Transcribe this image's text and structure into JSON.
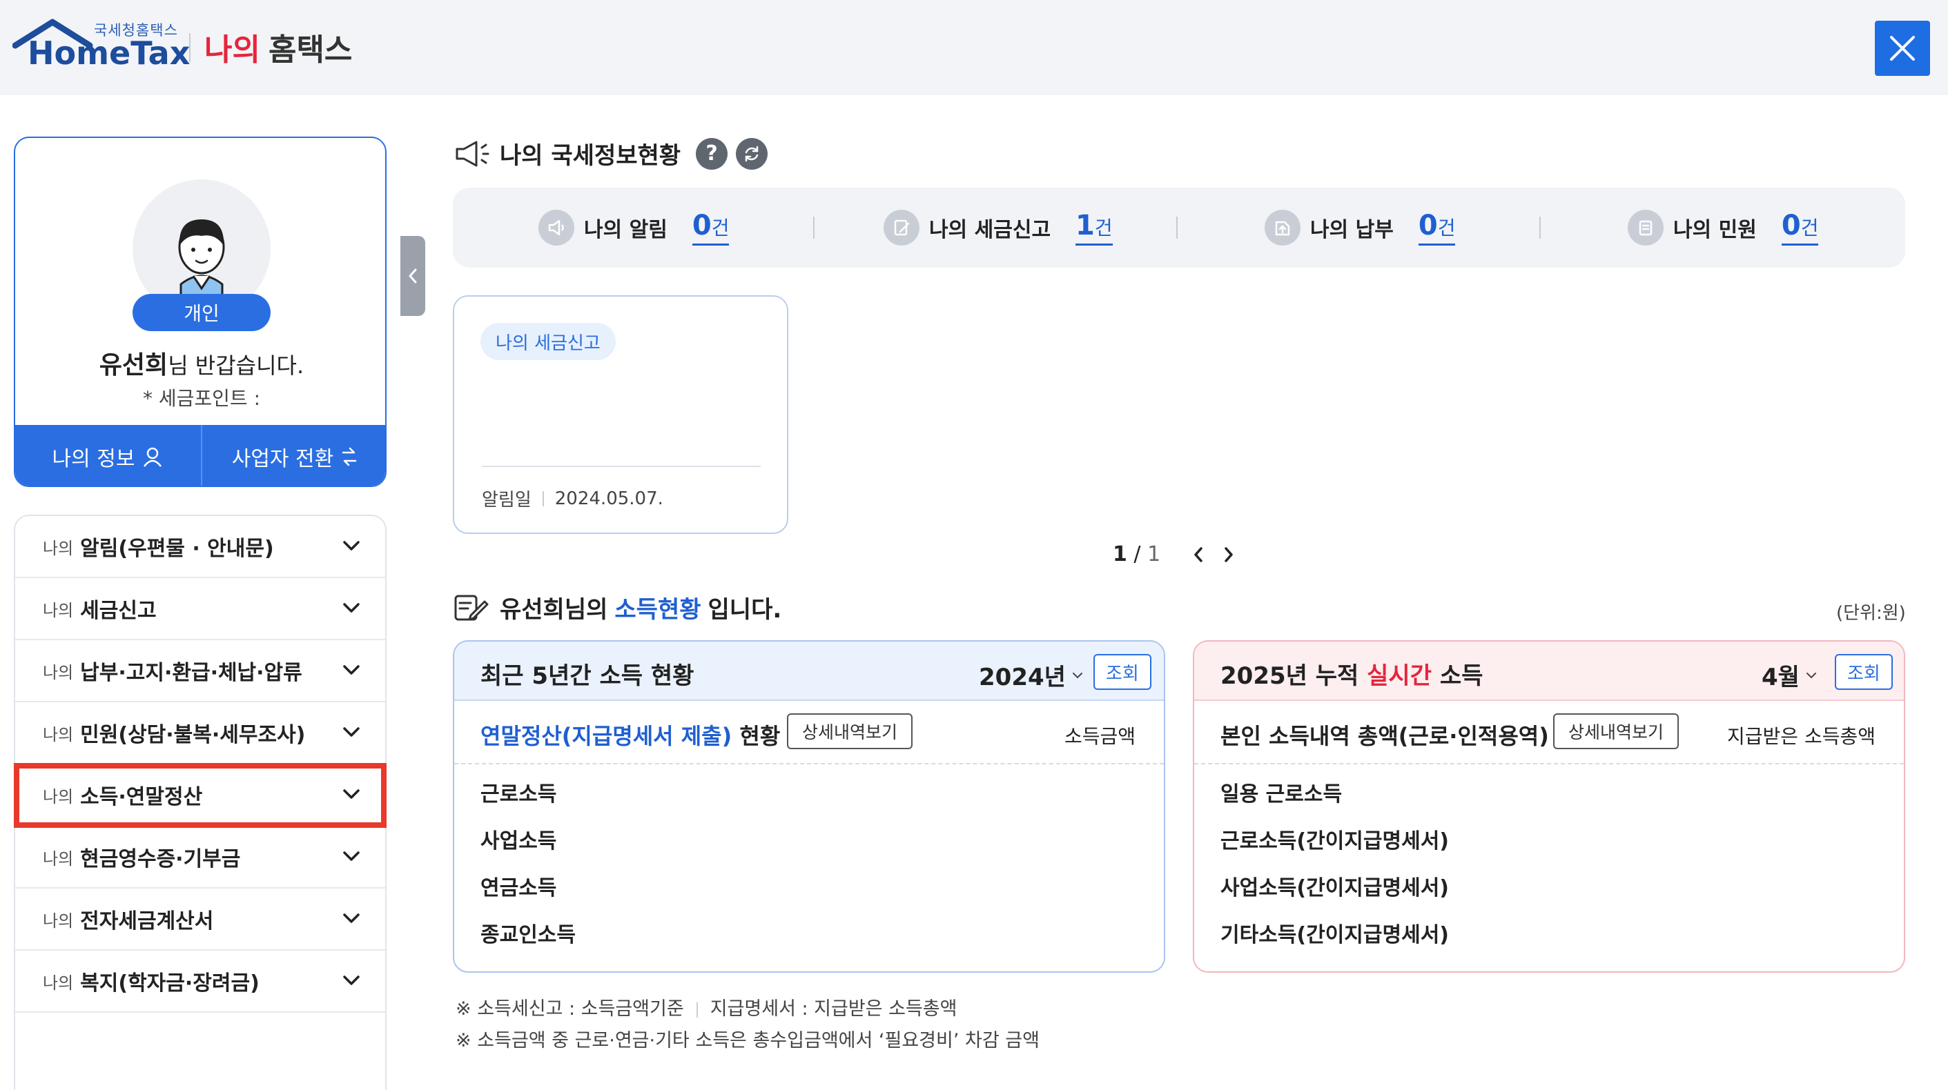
{
  "header": {
    "logo_small": "국세청홈택스",
    "logo_main": "HomeTax",
    "title_highlight": "나의",
    "title_rest": "홈택스"
  },
  "profile": {
    "badge": "개인",
    "name": "유선희",
    "greeting_suffix": "님 반갑습니다.",
    "points_label": "* 세금포인트 :",
    "my_info_label": "나의 정보",
    "switch_label": "사업자 전환"
  },
  "menu": {
    "prefix": "나의",
    "items": [
      {
        "label": "알림(우편물 · 안내문)"
      },
      {
        "label": "세금신고"
      },
      {
        "label": "납부·고지·환급·체납·압류"
      },
      {
        "label": "민원(상담·불복·세무조사)"
      },
      {
        "label": "소득·연말정산"
      },
      {
        "label": "현금영수증·기부금"
      },
      {
        "label": "전자세금계산서"
      },
      {
        "label": "복지(학자금·장려금)"
      }
    ]
  },
  "status": {
    "title": "나의 국세정보현황",
    "help": "?",
    "items": [
      {
        "label": "나의 알림",
        "count": "0",
        "unit": "건"
      },
      {
        "label": "나의 세금신고",
        "count": "1",
        "unit": "건"
      },
      {
        "label": "나의 납부",
        "count": "0",
        "unit": "건"
      },
      {
        "label": "나의 민원",
        "count": "0",
        "unit": "건"
      }
    ]
  },
  "notice_card": {
    "tag": "나의 세금신고",
    "date_label": "알림일",
    "date": "2024.05.07."
  },
  "pager": {
    "current": "1",
    "sep": " / ",
    "total": "1"
  },
  "income": {
    "title_name": "유선희님의",
    "title_highlight": "소득현황",
    "title_suffix": "입니다.",
    "unit": "(단위:원)",
    "left_panel": {
      "title": "최근 5년간 소득 현황",
      "year": "2024년",
      "query_btn": "조회",
      "sub_title_highlight": "연말정산(지급명세서 제출)",
      "sub_title_suffix": "현황",
      "detail_btn": "상세내역보기",
      "column": "소득금액",
      "rows": [
        "근로소득",
        "사업소득",
        "연금소득",
        "종교인소득"
      ]
    },
    "right_panel": {
      "title_prefix": "2025년 누적",
      "title_highlight": "실시간",
      "title_suffix": "소득",
      "month": "4월",
      "query_btn": "조회",
      "sub_title": "본인 소득내역 총액(근로·인적용역)",
      "detail_btn": "상세내역보기",
      "column": "지급받은 소득총액",
      "rows": [
        "일용 근로소득",
        "근로소득(간이지급명세서)",
        "사업소득(간이지급명세서)",
        "기타소득(간이지급명세서)"
      ]
    }
  },
  "footnotes": {
    "line1_a": "※ 소득세신고 : 소득금액기준",
    "line1_b": "지급명세서 : 지급받은 소득총액",
    "line2": "※ 소득금액 중 근로·연금·기타 소득은 총수입금액에서 ‘필요경비’ 차감 금액"
  },
  "colors": {
    "primary": "#2a6ee2",
    "brand_red": "#e5253c",
    "highlight_box": "#e8392b"
  }
}
